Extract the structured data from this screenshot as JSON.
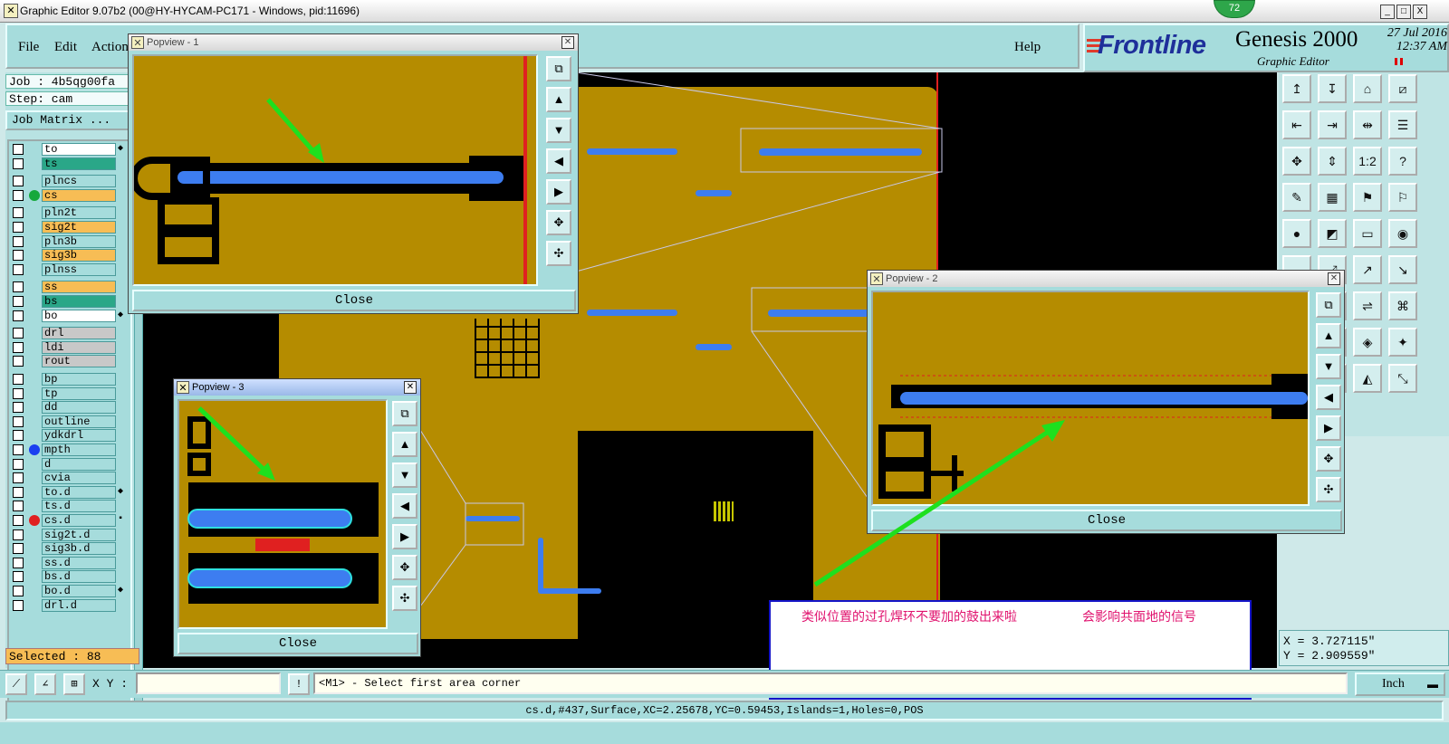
{
  "window": {
    "title": "Graphic Editor 9.07b2 (00@HY-HYCAM-PC171 - Windows, pid:11696)",
    "badge": "72",
    "minimize": "_",
    "maximize": "□",
    "close": "X"
  },
  "menu": {
    "file": "File",
    "edit": "Edit",
    "action": "Action",
    "help": "Help"
  },
  "brand": {
    "logo": "Frontline",
    "product": "Genesis 2000",
    "subtitle": "Graphic Editor",
    "date": "27 Jul 2016",
    "time": "12:37 AM"
  },
  "job": {
    "job_line": "Job : 4b5qg00fa",
    "step_line": "Step: cam",
    "matrix_button": "Job Matrix ..."
  },
  "layers": [
    {
      "name": "to",
      "color": "#ffffff",
      "mark": "◆"
    },
    {
      "name": "ts",
      "color": "#2aa788"
    },
    {
      "name": "plncs",
      "color": "#a6dcdc"
    },
    {
      "name": "cs",
      "color": "#f7bd55",
      "dot": "#16a83c"
    },
    {
      "name": "pln2t",
      "color": "#a6dcdc"
    },
    {
      "name": "sig2t",
      "color": "#f7bd55"
    },
    {
      "name": "pln3b",
      "color": "#a6dcdc"
    },
    {
      "name": "sig3b",
      "color": "#f7bd55"
    },
    {
      "name": "plnss",
      "color": "#a6dcdc"
    },
    {
      "name": "ss",
      "color": "#f7bd55"
    },
    {
      "name": "bs",
      "color": "#2aa788"
    },
    {
      "name": "bo",
      "color": "#ffffff",
      "mark": "◆"
    },
    {
      "name": "drl",
      "color": "#c8c8c8"
    },
    {
      "name": "ldi",
      "color": "#c8c8c8"
    },
    {
      "name": "rout",
      "color": "#c8c8c8"
    },
    {
      "name": "bp",
      "color": "#a6dcdc"
    },
    {
      "name": "tp",
      "color": "#a6dcdc"
    },
    {
      "name": "dd",
      "color": "#a6dcdc"
    },
    {
      "name": "outline",
      "color": "#a6dcdc"
    },
    {
      "name": "ydkdrl",
      "color": "#a6dcdc"
    },
    {
      "name": "mpth",
      "color": "#a6dcdc",
      "dot": "#1a3ff0"
    },
    {
      "name": "d",
      "color": "#a6dcdc"
    },
    {
      "name": "cvia",
      "color": "#a6dcdc"
    },
    {
      "name": "to.d",
      "color": "#a6dcdc",
      "mark": "◆"
    },
    {
      "name": "ts.d",
      "color": "#a6dcdc"
    },
    {
      "name": "cs.d",
      "color": "#a6dcdc",
      "dot": "#e02020",
      "mark": "▪"
    },
    {
      "name": "sig2t.d",
      "color": "#a6dcdc"
    },
    {
      "name": "sig3b.d",
      "color": "#a6dcdc"
    },
    {
      "name": "ss.d",
      "color": "#a6dcdc"
    },
    {
      "name": "bs.d",
      "color": "#a6dcdc"
    },
    {
      "name": "bo.d",
      "color": "#a6dcdc",
      "mark": "◆"
    },
    {
      "name": "drl.d",
      "color": "#a6dcdc"
    }
  ],
  "selected": "Selected : 88",
  "popviews": {
    "p1": {
      "title": "Popview - 1",
      "close": "Close"
    },
    "p2": {
      "title": "Popview - 2",
      "close": "Close"
    },
    "p3": {
      "title": "Popview - 3",
      "close": "Close"
    }
  },
  "annotation": {
    "text1": "类似位置的过孔焊环不要加的鼓出来啦",
    "text2": "会影响共面地的信号"
  },
  "coords": {
    "x": "X = 3.727115\"",
    "y": "Y = 2.909559\""
  },
  "bottom": {
    "xy_label": "X Y :",
    "xy_value": "",
    "prompt_icon": "!",
    "prompt": "<M1> - Select first area corner",
    "units": "Inch",
    "status": "cs.d,#437,Surface,XC=2.25678,YC=0.59453,Islands=1,Holes=0,POS"
  },
  "colors": {
    "board": "#b58c00",
    "trace": "#3d7df0",
    "arrow": "#1ee01e",
    "panel": "#a6dcdc"
  }
}
